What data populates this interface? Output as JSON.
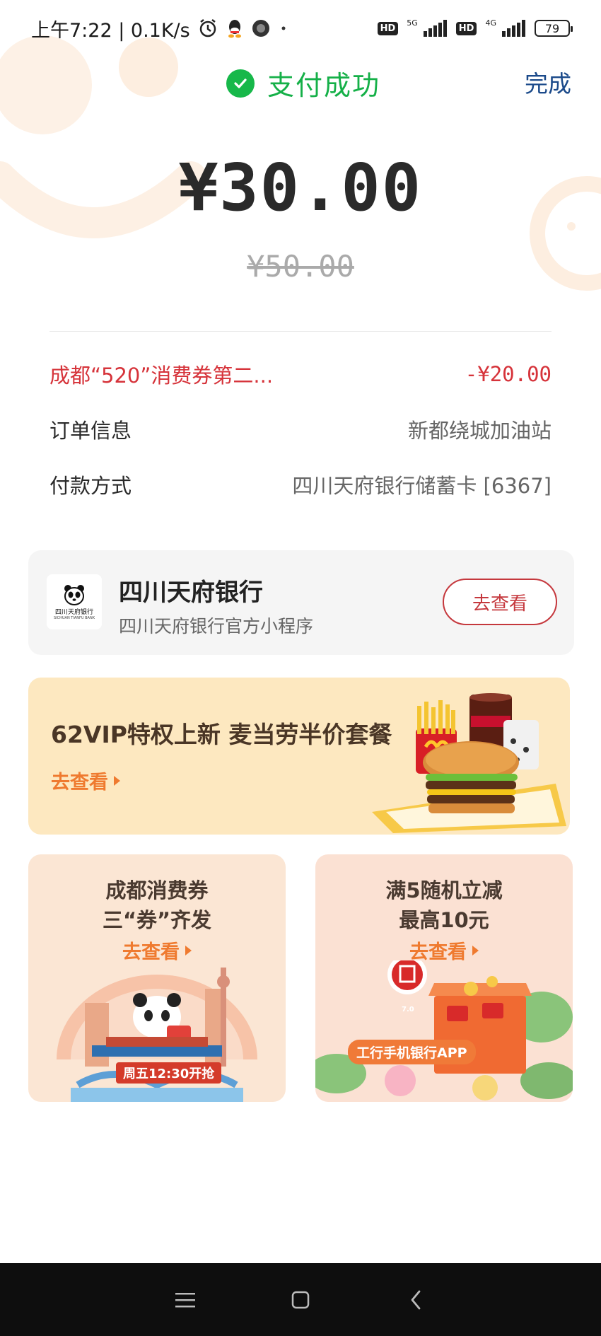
{
  "status_bar": {
    "time_speed": "上午7:22 | 0.1K/s",
    "net1_label": "5G",
    "net2_label": "4G",
    "hd": "HD",
    "battery": "79"
  },
  "header": {
    "success_text": "支付成功",
    "done_label": "完成"
  },
  "payment": {
    "amount": "¥30.00",
    "original_amount": "¥50.00"
  },
  "details": {
    "discount_label": "成都“520”消费券第二...",
    "discount_value": "-¥20.00",
    "order_label": "订单信息",
    "order_value": "新都绕城加油站",
    "method_label": "付款方式",
    "method_value": "四川天府银行储蓄卡 [6367]"
  },
  "bank_card": {
    "logo_cn": "四川天府银行",
    "logo_en": "SICHUAN TIANFU BANK",
    "name": "四川天府银行",
    "subtitle": "四川天府银行官方小程序",
    "button": "去查看"
  },
  "mcd_banner": {
    "title": "62VIP特权上新 麦当劳半价套餐",
    "link": "去查看"
  },
  "promo_left": {
    "line1": "成都消费券",
    "line2": "三“券”齐发",
    "link": "去查看",
    "badge": "周五12:30开抢"
  },
  "promo_right": {
    "line1": "满5随机立减",
    "line2": "最高10元",
    "link": "去查看",
    "badge": "工行手机银行APP",
    "version": "7.0"
  },
  "colors": {
    "success": "#17b84a",
    "accent_red": "#d6333a",
    "link_orange": "#ef7a2f",
    "done_blue": "#1b4a8a"
  }
}
